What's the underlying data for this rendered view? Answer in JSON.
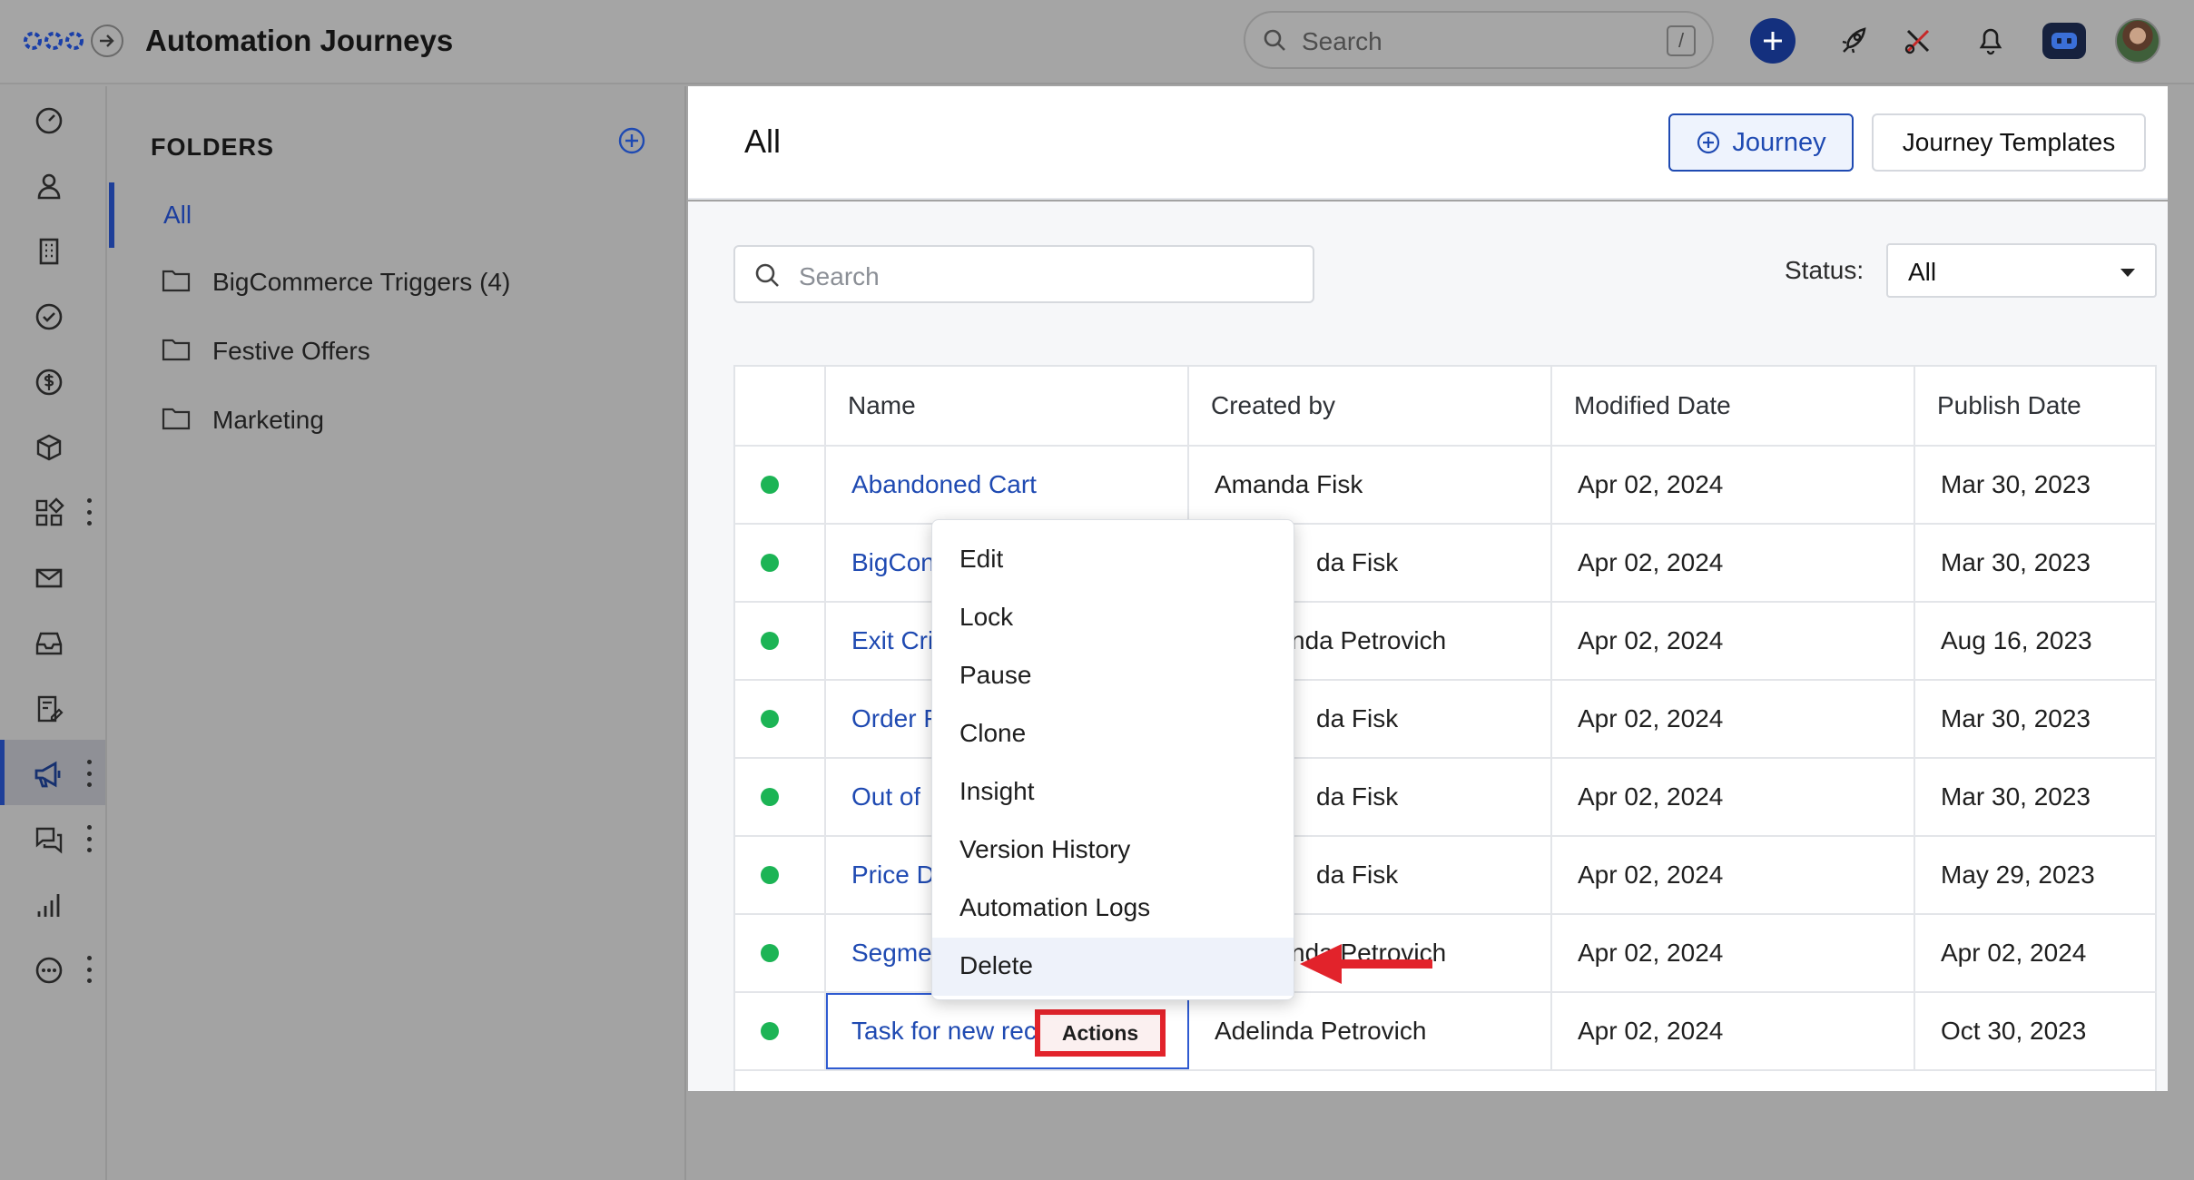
{
  "app": {
    "title": "Automation Journeys",
    "search_placeholder": "Search",
    "search_shortcut": "/"
  },
  "rail": {
    "items": [
      {
        "icon": "dashboard-gauge-icon"
      },
      {
        "icon": "user-icon"
      },
      {
        "icon": "building-icon"
      },
      {
        "icon": "check-circle-icon"
      },
      {
        "icon": "dollar-circle-icon"
      },
      {
        "icon": "box-icon"
      },
      {
        "icon": "apps-grid-icon"
      },
      {
        "icon": "mail-icon"
      },
      {
        "icon": "inbox-icon"
      },
      {
        "icon": "form-icon"
      },
      {
        "icon": "megaphone-icon",
        "active": true
      },
      {
        "icon": "chat-icon"
      },
      {
        "icon": "bar-chart-icon"
      },
      {
        "icon": "more-circle-icon"
      }
    ]
  },
  "folders": {
    "title": "FOLDERS",
    "all_label": "All",
    "items": [
      {
        "label": "BigCommerce Triggers (4)"
      },
      {
        "label": "Festive Offers"
      },
      {
        "label": "Marketing"
      }
    ]
  },
  "main": {
    "title": "All",
    "journey_button": "Journey",
    "templates_button": "Journey Templates",
    "search_placeholder": "Search",
    "status_label": "Status:",
    "status_value": "All"
  },
  "table": {
    "columns": [
      "Name",
      "Created by",
      "Modified Date",
      "Publish Date"
    ],
    "rows": [
      {
        "name": "Abandoned Cart",
        "created_by": "Amanda Fisk",
        "modified": "Apr 02, 2024",
        "published": "Mar 30, 2023"
      },
      {
        "name": "BigCon",
        "created_by": "da Fisk",
        "modified": "Apr 02, 2024",
        "published": "Mar 30, 2023"
      },
      {
        "name": "Exit Cri",
        "created_by": "nda Petrovich",
        "modified": "Apr 02, 2024",
        "published": "Aug 16, 2023"
      },
      {
        "name": "Order F",
        "created_by": "da Fisk",
        "modified": "Apr 02, 2024",
        "published": "Mar 30, 2023"
      },
      {
        "name": "Out of",
        "created_by": "da Fisk",
        "modified": "Apr 02, 2024",
        "published": "Mar 30, 2023"
      },
      {
        "name": "Price D",
        "created_by": "da Fisk",
        "modified": "Apr 02, 2024",
        "published": "May 29, 2023"
      },
      {
        "name": "Segme",
        "created_by": "nda Petrovich",
        "modified": "Apr 02, 2024",
        "published": "Apr 02, 2024"
      },
      {
        "name": "Task for new rec",
        "created_by": "Adelinda Petrovich",
        "modified": "Apr 02, 2024",
        "published": "Oct 30, 2023"
      }
    ],
    "actions_label": "Actions"
  },
  "context_menu": {
    "items": [
      "Edit",
      "Lock",
      "Pause",
      "Clone",
      "Insight",
      "Version History",
      "Automation Logs",
      "Delete"
    ]
  },
  "colors": {
    "accent": "#1f4ab2",
    "status_active": "#1cb455",
    "highlight_red": "#e2232b"
  }
}
